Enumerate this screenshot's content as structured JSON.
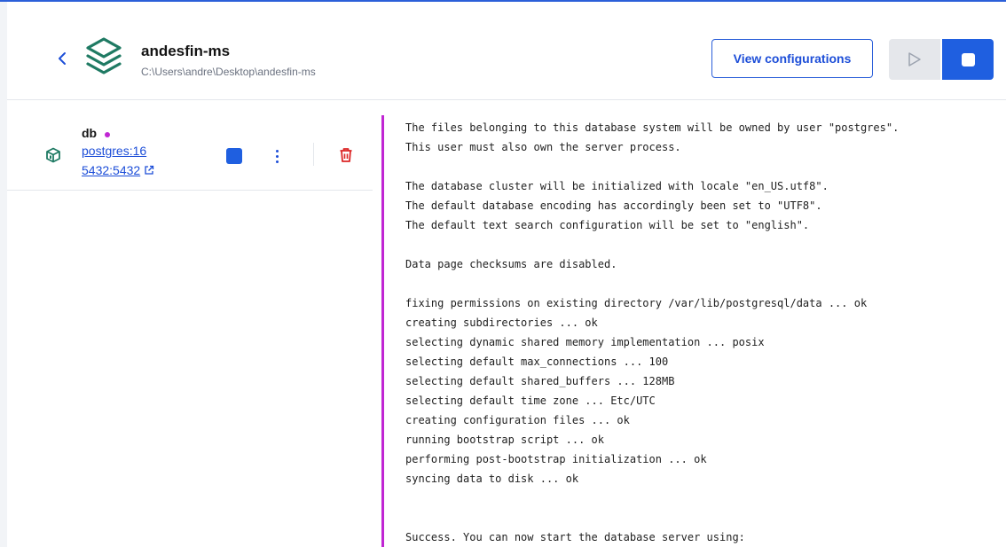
{
  "project": {
    "name": "andesfin-ms",
    "path": "C:\\Users\\andre\\Desktop\\andesfin-ms"
  },
  "toolbar": {
    "view_config_label": "View configurations"
  },
  "colors": {
    "accent": "#1f5fe0",
    "running_status": "#c026d3",
    "delete": "#dc2626"
  },
  "icons": {
    "back": "chevron-left-icon",
    "project": "stack-layers-icon",
    "container": "cube-icon",
    "port_link": "external-link-icon",
    "delete": "trash-icon"
  },
  "container": {
    "name": "db",
    "image": "postgres:16",
    "ports": "5432:5432"
  },
  "log": {
    "lines": [
      "The files belonging to this database system will be owned by user \"postgres\".",
      "This user must also own the server process.",
      "",
      "The database cluster will be initialized with locale \"en_US.utf8\".",
      "The default database encoding has accordingly been set to \"UTF8\".",
      "The default text search configuration will be set to \"english\".",
      "",
      "Data page checksums are disabled.",
      "",
      "fixing permissions on existing directory /var/lib/postgresql/data ... ok",
      "creating subdirectories ... ok",
      "selecting dynamic shared memory implementation ... posix",
      "selecting default max_connections ... 100",
      "selecting default shared_buffers ... 128MB",
      "selecting default time zone ... Etc/UTC",
      "creating configuration files ... ok",
      "running bootstrap script ... ok",
      "performing post-bootstrap initialization ... ok",
      "syncing data to disk ... ok",
      "",
      "",
      "Success. You can now start the database server using:"
    ]
  }
}
